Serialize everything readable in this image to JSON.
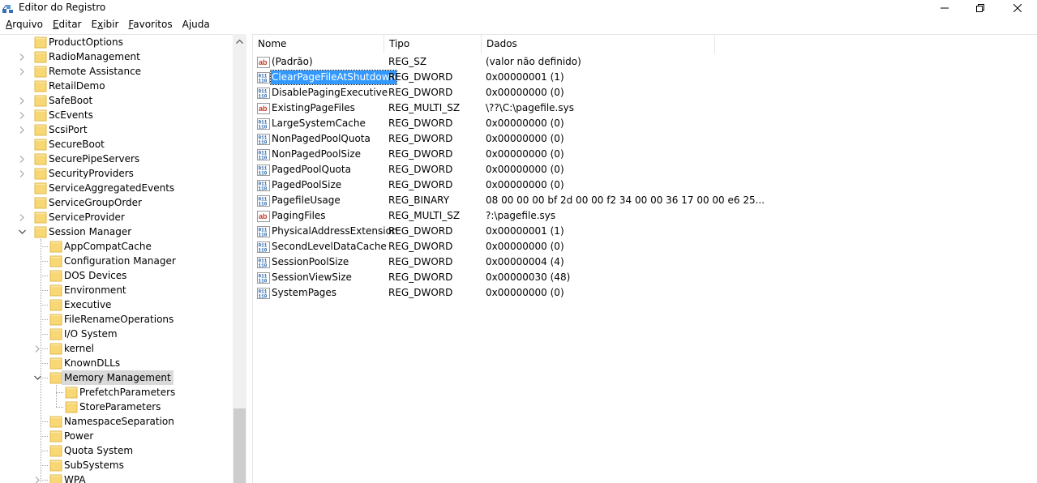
{
  "window": {
    "title": "Editor do Registro"
  },
  "menu": [
    {
      "label": "Arquivo",
      "mnemonic_underline": "A"
    },
    {
      "label": "Editar",
      "mnemonic_underline": "E"
    },
    {
      "label": "Exibir",
      "mnemonic_underline": "x"
    },
    {
      "label": "Favoritos",
      "mnemonic_underline": "F"
    },
    {
      "label": "Ajuda",
      "mnemonic_underline": "j"
    }
  ],
  "tree": {
    "items": [
      {
        "label": "ProductOptions",
        "level": 0,
        "expander": "none"
      },
      {
        "label": "RadioManagement",
        "level": 0,
        "expander": "collapsed"
      },
      {
        "label": "Remote Assistance",
        "level": 0,
        "expander": "collapsed"
      },
      {
        "label": "RetailDemo",
        "level": 0,
        "expander": "none"
      },
      {
        "label": "SafeBoot",
        "level": 0,
        "expander": "collapsed"
      },
      {
        "label": "ScEvents",
        "level": 0,
        "expander": "collapsed"
      },
      {
        "label": "ScsiPort",
        "level": 0,
        "expander": "collapsed"
      },
      {
        "label": "SecureBoot",
        "level": 0,
        "expander": "none"
      },
      {
        "label": "SecurePipeServers",
        "level": 0,
        "expander": "collapsed"
      },
      {
        "label": "SecurityProviders",
        "level": 0,
        "expander": "collapsed"
      },
      {
        "label": "ServiceAggregatedEvents",
        "level": 0,
        "expander": "none"
      },
      {
        "label": "ServiceGroupOrder",
        "level": 0,
        "expander": "none"
      },
      {
        "label": "ServiceProvider",
        "level": 0,
        "expander": "collapsed"
      },
      {
        "label": "Session Manager",
        "level": 0,
        "expander": "expanded"
      },
      {
        "label": "AppCompatCache",
        "level": 1,
        "expander": "none"
      },
      {
        "label": "Configuration Manager",
        "level": 1,
        "expander": "none"
      },
      {
        "label": "DOS Devices",
        "level": 1,
        "expander": "none"
      },
      {
        "label": "Environment",
        "level": 1,
        "expander": "none"
      },
      {
        "label": "Executive",
        "level": 1,
        "expander": "none"
      },
      {
        "label": "FileRenameOperations",
        "level": 1,
        "expander": "none"
      },
      {
        "label": "I/O System",
        "level": 1,
        "expander": "none"
      },
      {
        "label": "kernel",
        "level": 1,
        "expander": "collapsed"
      },
      {
        "label": "KnownDLLs",
        "level": 1,
        "expander": "none"
      },
      {
        "label": "Memory Management",
        "level": 1,
        "expander": "expanded",
        "selected": true
      },
      {
        "label": "PrefetchParameters",
        "level": 2,
        "expander": "none"
      },
      {
        "label": "StoreParameters",
        "level": 2,
        "expander": "none"
      },
      {
        "label": "NamespaceSeparation",
        "level": 1,
        "expander": "none"
      },
      {
        "label": "Power",
        "level": 1,
        "expander": "none"
      },
      {
        "label": "Quota System",
        "level": 1,
        "expander": "none"
      },
      {
        "label": "SubSystems",
        "level": 1,
        "expander": "none"
      },
      {
        "label": "WPA",
        "level": 1,
        "expander": "collapsed"
      }
    ]
  },
  "list": {
    "columns": {
      "name": "Nome",
      "type": "Tipo",
      "data": "Dados"
    },
    "rows": [
      {
        "name": "(Padrão)",
        "type": "REG_SZ",
        "data": "(valor não definido)",
        "icon": "string-value-icon"
      },
      {
        "name": "ClearPageFileAtShutdown",
        "type": "REG_DWORD",
        "data": "0x00000001 (1)",
        "icon": "binary-value-icon",
        "selected": true
      },
      {
        "name": "DisablePagingExecutive",
        "type": "REG_DWORD",
        "data": "0x00000000 (0)",
        "icon": "binary-value-icon"
      },
      {
        "name": "ExistingPageFiles",
        "type": "REG_MULTI_SZ",
        "data": "\\??\\C:\\pagefile.sys",
        "icon": "string-value-icon"
      },
      {
        "name": "LargeSystemCache",
        "type": "REG_DWORD",
        "data": "0x00000000 (0)",
        "icon": "binary-value-icon"
      },
      {
        "name": "NonPagedPoolQuota",
        "type": "REG_DWORD",
        "data": "0x00000000 (0)",
        "icon": "binary-value-icon"
      },
      {
        "name": "NonPagedPoolSize",
        "type": "REG_DWORD",
        "data": "0x00000000 (0)",
        "icon": "binary-value-icon"
      },
      {
        "name": "PagedPoolQuota",
        "type": "REG_DWORD",
        "data": "0x00000000 (0)",
        "icon": "binary-value-icon"
      },
      {
        "name": "PagedPoolSize",
        "type": "REG_DWORD",
        "data": "0x00000000 (0)",
        "icon": "binary-value-icon"
      },
      {
        "name": "PagefileUsage",
        "type": "REG_BINARY",
        "data": "08 00 00 00 bf 2d 00 00 f2 34 00 00 36 17 00 00 e6 25...",
        "icon": "binary-value-icon"
      },
      {
        "name": "PagingFiles",
        "type": "REG_MULTI_SZ",
        "data": "?:\\pagefile.sys",
        "icon": "string-value-icon"
      },
      {
        "name": "PhysicalAddressExtension",
        "type": "REG_DWORD",
        "data": "0x00000001 (1)",
        "icon": "binary-value-icon"
      },
      {
        "name": "SecondLevelDataCache",
        "type": "REG_DWORD",
        "data": "0x00000000 (0)",
        "icon": "binary-value-icon"
      },
      {
        "name": "SessionPoolSize",
        "type": "REG_DWORD",
        "data": "0x00000004 (4)",
        "icon": "binary-value-icon"
      },
      {
        "name": "SessionViewSize",
        "type": "REG_DWORD",
        "data": "0x00000030 (48)",
        "icon": "binary-value-icon"
      },
      {
        "name": "SystemPages",
        "type": "REG_DWORD",
        "data": "0x00000000 (0)",
        "icon": "binary-value-icon"
      }
    ]
  },
  "colors": {
    "selection_focused": "#3399ff",
    "selection_unfocused": "#d9d9d9",
    "folder": "#f8d775",
    "string_icon_red": "#c0392b",
    "binary_icon_blue": "#1f5fa8"
  }
}
